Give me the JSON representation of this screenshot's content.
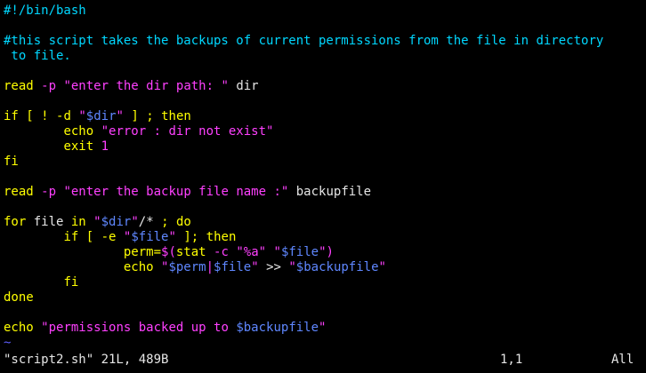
{
  "colors": {
    "background": "#000000",
    "comment": "#00d7ff",
    "keyword": "#ffff00",
    "string": "#ff40ff",
    "variable": "#5f87ff",
    "plain": "#e6e6e6",
    "tilde": "#5f5fff"
  },
  "lines": [
    [
      {
        "t": "#!/bin/bash",
        "c": "comment"
      }
    ],
    [
      {
        "t": "",
        "c": "plain"
      }
    ],
    [
      {
        "t": "#this script takes the backups of current permissions from the file in directory",
        "c": "comment"
      }
    ],
    [
      {
        "t": " to file.",
        "c": "comment"
      }
    ],
    [
      {
        "t": "",
        "c": "plain"
      }
    ],
    [
      {
        "t": "read",
        "c": "keyword"
      },
      {
        "t": " ",
        "c": "plain"
      },
      {
        "t": "-p",
        "c": "string"
      },
      {
        "t": " ",
        "c": "plain"
      },
      {
        "t": "\"enter the dir path: \"",
        "c": "string"
      },
      {
        "t": " dir",
        "c": "plain"
      }
    ],
    [
      {
        "t": "",
        "c": "plain"
      }
    ],
    [
      {
        "t": "if",
        "c": "keyword"
      },
      {
        "t": " ",
        "c": "plain"
      },
      {
        "t": "[",
        "c": "keyword"
      },
      {
        "t": " ",
        "c": "plain"
      },
      {
        "t": "!",
        "c": "keyword"
      },
      {
        "t": " ",
        "c": "plain"
      },
      {
        "t": "-d",
        "c": "keyword"
      },
      {
        "t": " ",
        "c": "plain"
      },
      {
        "t": "\"",
        "c": "string"
      },
      {
        "t": "$dir",
        "c": "variable"
      },
      {
        "t": "\"",
        "c": "string"
      },
      {
        "t": " ",
        "c": "plain"
      },
      {
        "t": "]",
        "c": "keyword"
      },
      {
        "t": " ",
        "c": "plain"
      },
      {
        "t": ";",
        "c": "keyword"
      },
      {
        "t": " ",
        "c": "plain"
      },
      {
        "t": "then",
        "c": "keyword"
      }
    ],
    [
      {
        "t": "        ",
        "c": "plain"
      },
      {
        "t": "echo",
        "c": "keyword"
      },
      {
        "t": " ",
        "c": "plain"
      },
      {
        "t": "\"error : dir not exist\"",
        "c": "string"
      }
    ],
    [
      {
        "t": "        ",
        "c": "plain"
      },
      {
        "t": "exit",
        "c": "keyword"
      },
      {
        "t": " ",
        "c": "plain"
      },
      {
        "t": "1",
        "c": "string"
      }
    ],
    [
      {
        "t": "fi",
        "c": "keyword"
      }
    ],
    [
      {
        "t": "",
        "c": "plain"
      }
    ],
    [
      {
        "t": "read",
        "c": "keyword"
      },
      {
        "t": " ",
        "c": "plain"
      },
      {
        "t": "-p",
        "c": "string"
      },
      {
        "t": " ",
        "c": "plain"
      },
      {
        "t": "\"enter the backup file name :\"",
        "c": "string"
      },
      {
        "t": " backupfile",
        "c": "plain"
      }
    ],
    [
      {
        "t": "",
        "c": "plain"
      }
    ],
    [
      {
        "t": "for",
        "c": "keyword"
      },
      {
        "t": " file ",
        "c": "plain"
      },
      {
        "t": "in",
        "c": "keyword"
      },
      {
        "t": " ",
        "c": "plain"
      },
      {
        "t": "\"",
        "c": "string"
      },
      {
        "t": "$dir",
        "c": "variable"
      },
      {
        "t": "\"",
        "c": "string"
      },
      {
        "t": "/*",
        "c": "plain"
      },
      {
        "t": " ",
        "c": "plain"
      },
      {
        "t": ";",
        "c": "keyword"
      },
      {
        "t": " ",
        "c": "plain"
      },
      {
        "t": "do",
        "c": "keyword"
      }
    ],
    [
      {
        "t": "        ",
        "c": "plain"
      },
      {
        "t": "if",
        "c": "keyword"
      },
      {
        "t": " ",
        "c": "plain"
      },
      {
        "t": "[",
        "c": "keyword"
      },
      {
        "t": " ",
        "c": "plain"
      },
      {
        "t": "-e",
        "c": "keyword"
      },
      {
        "t": " ",
        "c": "plain"
      },
      {
        "t": "\"",
        "c": "string"
      },
      {
        "t": "$file",
        "c": "variable"
      },
      {
        "t": "\"",
        "c": "string"
      },
      {
        "t": " ",
        "c": "plain"
      },
      {
        "t": "];",
        "c": "keyword"
      },
      {
        "t": " ",
        "c": "plain"
      },
      {
        "t": "then",
        "c": "keyword"
      }
    ],
    [
      {
        "t": "                ",
        "c": "plain"
      },
      {
        "t": "perm=",
        "c": "keyword"
      },
      {
        "t": "$(",
        "c": "string"
      },
      {
        "t": "stat",
        "c": "keyword"
      },
      {
        "t": " ",
        "c": "plain"
      },
      {
        "t": "-c",
        "c": "string"
      },
      {
        "t": " ",
        "c": "plain"
      },
      {
        "t": "\"",
        "c": "string"
      },
      {
        "t": "%a",
        "c": "string"
      },
      {
        "t": "\"",
        "c": "string"
      },
      {
        "t": " ",
        "c": "plain"
      },
      {
        "t": "\"",
        "c": "string"
      },
      {
        "t": "$file",
        "c": "variable"
      },
      {
        "t": "\"",
        "c": "string"
      },
      {
        "t": ")",
        "c": "string"
      }
    ],
    [
      {
        "t": "                ",
        "c": "plain"
      },
      {
        "t": "echo",
        "c": "keyword"
      },
      {
        "t": " ",
        "c": "plain"
      },
      {
        "t": "\"",
        "c": "string"
      },
      {
        "t": "$perm",
        "c": "variable"
      },
      {
        "t": "|",
        "c": "string"
      },
      {
        "t": "$file",
        "c": "variable"
      },
      {
        "t": "\"",
        "c": "string"
      },
      {
        "t": " >> ",
        "c": "plain"
      },
      {
        "t": "\"",
        "c": "string"
      },
      {
        "t": "$backupfile",
        "c": "variable"
      },
      {
        "t": "\"",
        "c": "string"
      }
    ],
    [
      {
        "t": "        ",
        "c": "plain"
      },
      {
        "t": "fi",
        "c": "keyword"
      }
    ],
    [
      {
        "t": "done",
        "c": "keyword"
      }
    ],
    [
      {
        "t": "",
        "c": "plain"
      }
    ],
    [
      {
        "t": "echo",
        "c": "keyword"
      },
      {
        "t": " ",
        "c": "plain"
      },
      {
        "t": "\"permissions backed up to ",
        "c": "string"
      },
      {
        "t": "$backupfile",
        "c": "variable"
      },
      {
        "t": "\"",
        "c": "string"
      }
    ]
  ],
  "tilde_lines": [
    "~"
  ],
  "status": {
    "file_info": "\"script2.sh\" 21L, 489B",
    "cursor_pos": "1,1",
    "scroll_pct": "All"
  }
}
